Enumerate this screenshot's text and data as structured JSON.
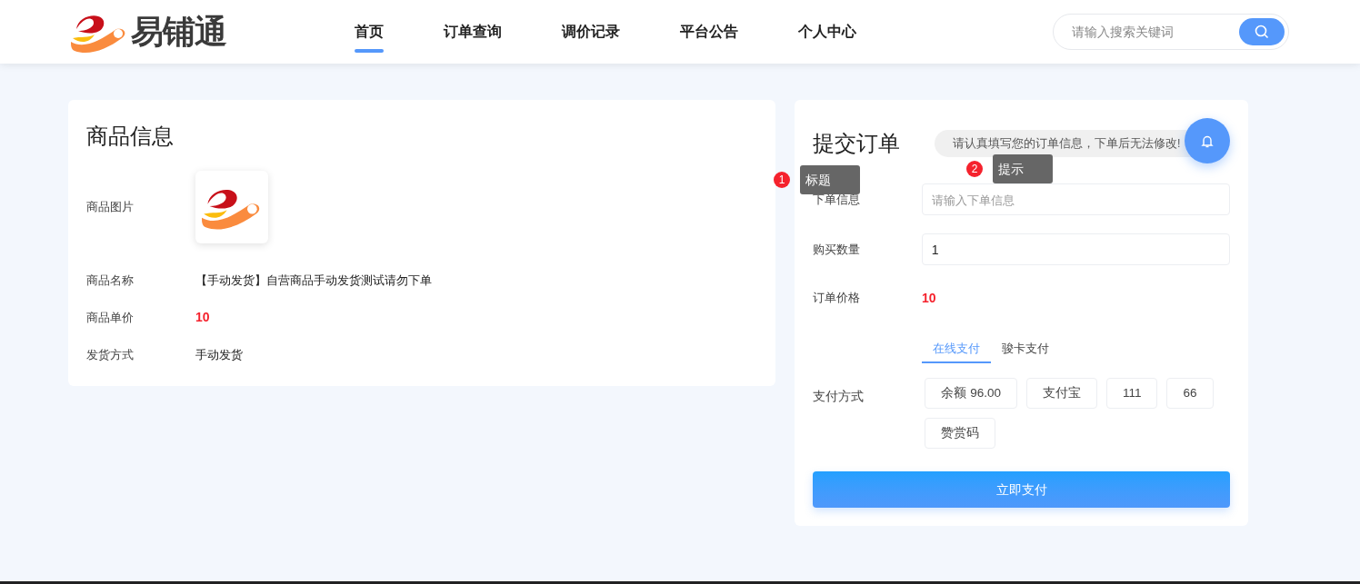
{
  "header": {
    "logo_text": "易铺通",
    "nav": [
      {
        "label": "首页",
        "selected": true
      },
      {
        "label": "订单查询",
        "selected": false
      },
      {
        "label": "调价记录",
        "selected": false
      },
      {
        "label": "平台公告",
        "selected": false
      },
      {
        "label": "个人中心",
        "selected": false
      }
    ],
    "search": {
      "placeholder": "请输入搜索关键词"
    }
  },
  "product": {
    "title": "商品信息",
    "rows": [
      {
        "kind": "image",
        "label": "商品图片"
      },
      {
        "kind": "text",
        "label": "商品名称",
        "value": "【手动发货】自营商品手动发货测试请勿下单"
      },
      {
        "kind": "price",
        "label": "商品单价",
        "value": "10"
      },
      {
        "kind": "text",
        "label": "发货方式",
        "value": "手动发货"
      }
    ]
  },
  "order": {
    "title": "提交订单",
    "notice": "请认真填写您的订单信息，下单后无法修改!",
    "fields": [
      {
        "kind": "input",
        "label": "下单信息",
        "placeholder": "请输入下单信息"
      },
      {
        "kind": "input",
        "label": "购买数量",
        "value": "1"
      },
      {
        "kind": "price",
        "label": "订单价格",
        "value": "10"
      }
    ],
    "pay_tabs": [
      {
        "label": "在线支付",
        "selected": true
      },
      {
        "label": "骏卡支付",
        "selected": false
      }
    ],
    "pay_label": "支付方式",
    "pay_options": [
      "余额 96.00",
      "支付宝",
      "111",
      "66",
      "赞赏码"
    ],
    "submit": "立即支付"
  },
  "guide": [
    {
      "number": "1",
      "text": "标题"
    },
    {
      "number": "2",
      "text": "提示"
    }
  ]
}
